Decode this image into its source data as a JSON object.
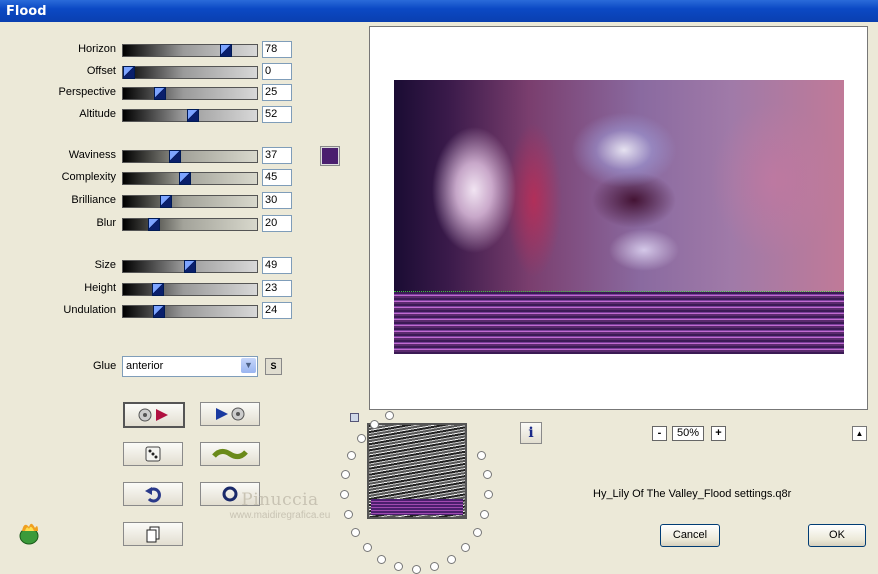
{
  "window": {
    "title": "Flood"
  },
  "sliders": [
    {
      "label": "Horizon",
      "value": "78",
      "fraction": 0.78
    },
    {
      "label": "Offset",
      "value": "0",
      "fraction": 0.0
    },
    {
      "label": "Perspective",
      "value": "25",
      "fraction": 0.25
    },
    {
      "label": "Altitude",
      "value": "52",
      "fraction": 0.52
    },
    {
      "label": "Waviness",
      "value": "37",
      "fraction": 0.37
    },
    {
      "label": "Complexity",
      "value": "45",
      "fraction": 0.45
    },
    {
      "label": "Brilliance",
      "value": "30",
      "fraction": 0.3
    },
    {
      "label": "Blur",
      "value": "20",
      "fraction": 0.2
    },
    {
      "label": "Size",
      "value": "49",
      "fraction": 0.49
    },
    {
      "label": "Height",
      "value": "23",
      "fraction": 0.23
    },
    {
      "label": "Undulation",
      "value": "24",
      "fraction": 0.24
    }
  ],
  "color_swatch": "#4a1f6e",
  "glue": {
    "label": "Glue",
    "value": "anterior",
    "s_button": "S"
  },
  "zoom": {
    "value": "50%",
    "minus": "-",
    "plus": "+"
  },
  "info_button": "i",
  "filename": "Hy_Lily Of The Valley_Flood settings.q8r",
  "watermark": {
    "line1": "Pinuccia",
    "line2": "www.maidiregrafica.eu"
  },
  "buttons": {
    "cancel": "Cancel",
    "ok": "OK"
  },
  "tool_icons": [
    "random-preset-icon",
    "load-preset-icon",
    "dice-icon",
    "wave-icon",
    "undo-icon",
    "reset-icon",
    "copy-icon"
  ]
}
